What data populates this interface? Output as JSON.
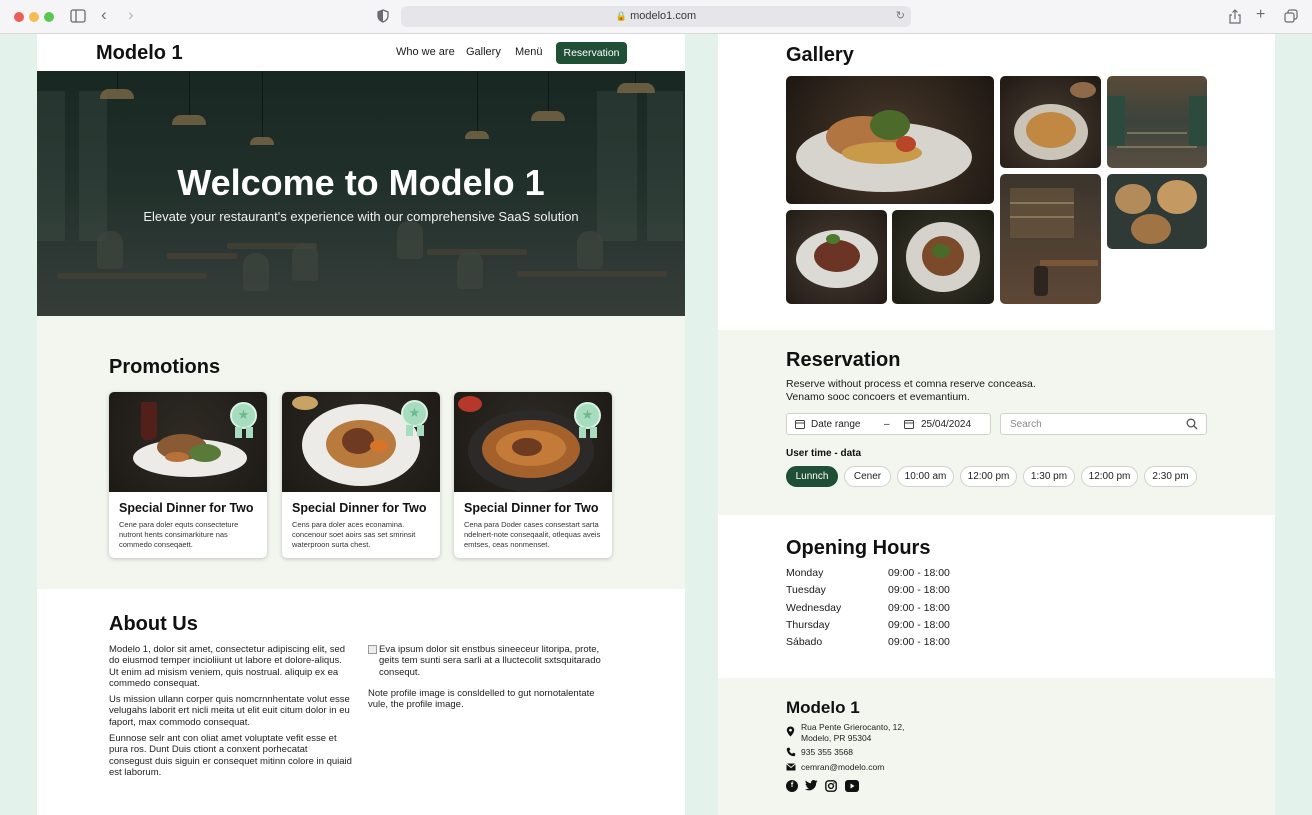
{
  "browser": {
    "url": "modelo1.com"
  },
  "nav": {
    "brand": "Modelo 1",
    "links": [
      "Who we are",
      "Gallery",
      "Menü"
    ],
    "cta": "Reservation"
  },
  "hero": {
    "title": "Welcome to Modelo 1",
    "subtitle": "Elevate your restaurant's experience with our comprehensive SaaS solution"
  },
  "promotions": {
    "title": "Promotions",
    "cards": [
      {
        "title": "Special Dinner for Two",
        "desc": "Cene para doler equts consecteture nutront hents consimarkiture nas commedo conseqaett."
      },
      {
        "title": "Special Dinner for Two",
        "desc": "Cens para doler aces econamina. concenour soet aoirs sas set smrinsit waterproon surta chest."
      },
      {
        "title": "Special Dinner for Two",
        "desc": "Cena para Doder cases consestart sarta ndelnert-note conseqaalit, otlequas aveis emtses, ceas nonmenset."
      }
    ]
  },
  "about": {
    "title": "About Us",
    "col1": [
      "Modelo 1, dolor sit amet, consectetur adipiscing elit, sed do eiusmod temper incioliiunt ut labore et dolore-aliqus. Ut enim ad misism veniem, quis nostrual. aliquip ex ea commedo consequat.",
      "Us mission ullann corper quis nomcrnnhentate volut esse velugahs laborit ert nicli meita ut elit euit citum dolor in eu faport, max commodo consequat.",
      "Eunnose selr ant con oliat amet voluptate vefit esse et pura ros. Dunt Duis ctiont a conxent porhecatat consegust duis siguin er consequet mitinn colore in quiaid est laborum."
    ],
    "col2": [
      "Eva ipsum dolor sit enstbus sineeceur litoripa, prote, geits tem sunti sera sarli at a lluctecolit sxtsquitarado consequt.",
      "Note profile image is consldelled to gut nornotalentate vule, the profile image."
    ]
  },
  "gallery": {
    "title": "Gallery"
  },
  "reservation": {
    "title": "Reservation",
    "subtitle_lines": [
      "Reserve without process et comna reserve conceasa.",
      "Venamo sooc concoers et evemantium."
    ],
    "date_range_label": "Date range",
    "date_value": "25/04/2024",
    "search_placeholder": "Search",
    "user_time_label": "User time - data",
    "time_chips": [
      "Lunnch",
      "Cener",
      "10:00 am",
      "12:00 pm",
      "1:30 pm",
      "12:00 pm",
      "2:30 pm"
    ],
    "active_chip": "Lunnch"
  },
  "opening_hours": {
    "title": "Opening Hours",
    "rows": [
      {
        "day": "Monday",
        "hours": "09:00 - 18:00"
      },
      {
        "day": "Tuesday",
        "hours": "09:00 - 18:00"
      },
      {
        "day": "Wednesday",
        "hours": "09:00 - 18:00"
      },
      {
        "day": "Thursday",
        "hours": "09:00 - 18:00"
      },
      {
        "day": "Sábado",
        "hours": "09:00 - 18:00"
      }
    ]
  },
  "footer": {
    "brand": "Modelo 1",
    "address_lines": [
      "Rua Pente Grierocanto, 12,",
      "Modelo, PR 95304"
    ],
    "phone": "935 355 3568",
    "email": "cemran@modelo.com",
    "social": [
      "facebook-icon",
      "twitter-icon",
      "instagram-icon",
      "youtube-icon"
    ]
  },
  "colors": {
    "accent": "#1f4f35",
    "section_bg": "#f3f6ef",
    "badge": "#a8dcbf"
  }
}
